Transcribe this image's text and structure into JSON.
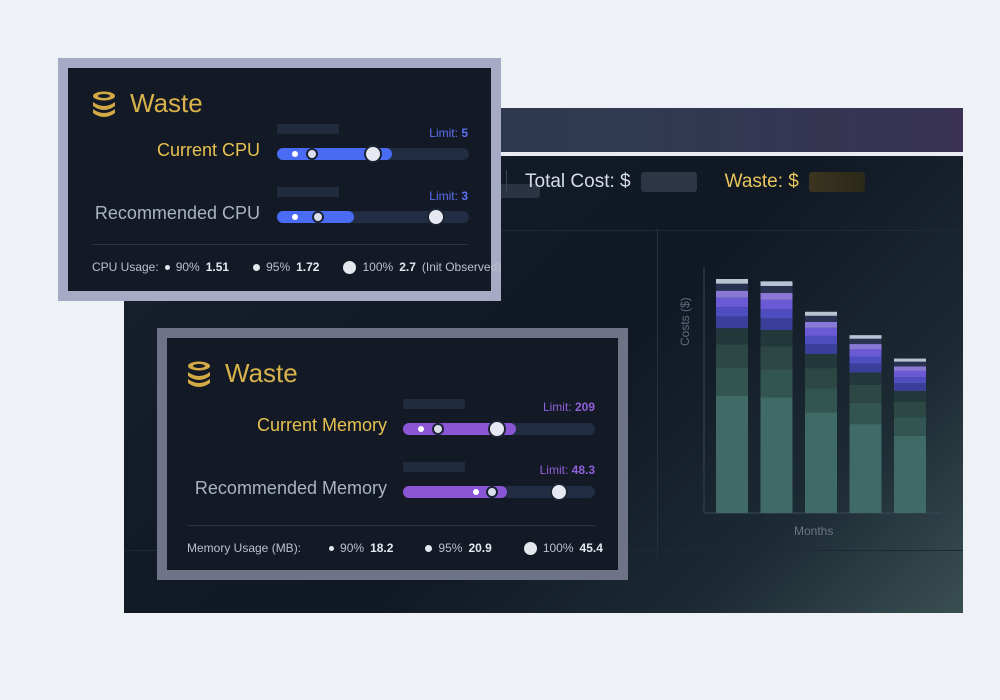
{
  "dashboard": {
    "total_cost_label": "Total Cost: $",
    "waste_label": "Waste: $"
  },
  "chart_data": {
    "type": "bar",
    "stacked": true,
    "ylabel": "Costs ($)",
    "xlabel": "Months",
    "categories": [
      "",
      "",
      "",
      "",
      ""
    ],
    "totals": [
      100,
      99,
      86,
      76,
      66
    ],
    "segment_colors": [
      "#3f6a66",
      "#335552",
      "#2c4744",
      "#23383a",
      "#3a3f9a",
      "#4e4ec0",
      "#6a5ad6",
      "#8a78d6",
      "#2a3252",
      "#b8c4d4"
    ]
  },
  "cpu_card": {
    "title": "Waste",
    "current_label": "Current CPU",
    "current_limit_prefix": "Limit: ",
    "current_limit": "5",
    "current_fill": 0.6,
    "current_knob": 0.5,
    "recommended_label": "Recommended CPU",
    "recommended_limit_prefix": "Limit: ",
    "recommended_limit": "3",
    "recommended_fill": 0.4,
    "recommended_knob": 0.83,
    "usage_label": "CPU Usage:",
    "p90_label": "90%",
    "p90_value": "1.51",
    "p95_label": "95%",
    "p95_value": "1.72",
    "p100_label": "100%",
    "p100_value": "2.7",
    "p100_suffix": "(Init Observed)",
    "accent": "#4a6cf5"
  },
  "mem_card": {
    "title": "Waste",
    "current_label": "Current Memory",
    "current_limit_prefix": "Limit: ",
    "current_limit": "209",
    "current_fill": 0.59,
    "current_knob": 0.49,
    "recommended_label": "Recommended Memory",
    "recommended_limit_prefix": "Limit: ",
    "recommended_limit": "48.3",
    "recommended_fill": 0.54,
    "recommended_knob": 0.81,
    "usage_label": "Memory Usage (MB):",
    "p90_label": "90%",
    "p90_value": "18.2",
    "p95_label": "95%",
    "p95_value": "20.9",
    "p100_label": "100%",
    "p100_value": "45.4",
    "accent": "#8a56d6"
  },
  "icons": {
    "coin": "coin-stack-icon"
  }
}
